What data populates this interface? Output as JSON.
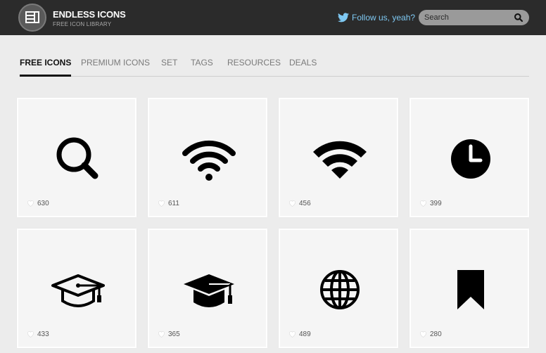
{
  "header": {
    "brand_title": "ENDLESS ICONS",
    "brand_sub": "FREE ICON LIBRARY",
    "follow_label": "Follow us, yeah?",
    "search_placeholder": "Search"
  },
  "colors": {
    "header_bg": "#2b2b2b",
    "follow_link": "#7ec8f2",
    "page_bg": "#ececec"
  },
  "tabs": [
    {
      "label": "FREE ICONS",
      "active": true
    },
    {
      "label": "PREMIUM ICONS",
      "active": false
    },
    {
      "label": "SET",
      "active": false
    },
    {
      "label": "TAGS",
      "active": false
    },
    {
      "label": "RESOURCES",
      "active": false
    },
    {
      "label": "DEALS",
      "active": false
    }
  ],
  "cards": [
    {
      "icon": "search-icon",
      "likes": "630"
    },
    {
      "icon": "wifi-icon",
      "likes": "611"
    },
    {
      "icon": "wifi-solid-icon",
      "likes": "456"
    },
    {
      "icon": "clock-icon",
      "likes": "399"
    },
    {
      "icon": "graduation-cap-outline-icon",
      "likes": "433"
    },
    {
      "icon": "graduation-cap-icon",
      "likes": "365"
    },
    {
      "icon": "globe-icon",
      "likes": "489"
    },
    {
      "icon": "bookmark-icon",
      "likes": "280"
    }
  ]
}
